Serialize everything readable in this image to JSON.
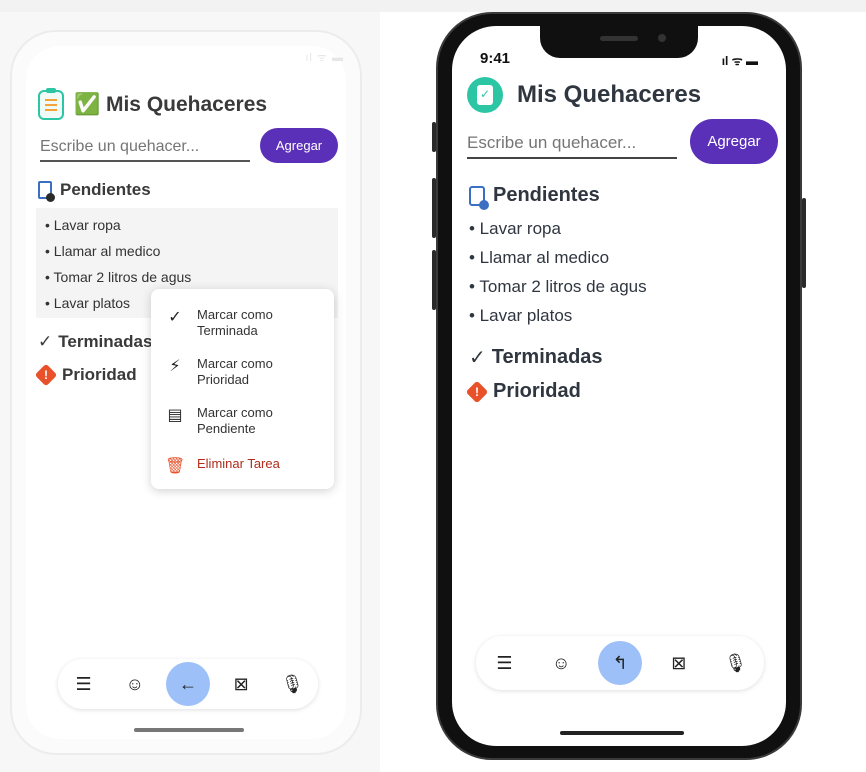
{
  "left_screen": {
    "title": "✅ Mis Quehaceres",
    "input_placeholder": "Escribe un quehacer...",
    "add_button": "Agregar",
    "sections": {
      "pending": "Pendientes",
      "done": "Terminadas",
      "priority": "Prioridad"
    },
    "pending_items": [
      "• Lavar ropa",
      "• Llamar al medico",
      "• Tomar 2 litros de agus",
      "• Lavar platos"
    ],
    "context_menu": {
      "mark_done": "Marcar como Terminada",
      "mark_priority": "Marcar como Prioridad",
      "mark_pending": "Marcar como Pendiente",
      "delete": "Eliminar Tarea"
    },
    "status_bar": "ıl ᯤ ▬"
  },
  "right_screen": {
    "time": "9:41",
    "status_icons": "ıl ᯤ ▬",
    "title": "Mis Quehaceres",
    "input_placeholder": "Escribe un quehacer...",
    "add_button": "Agregar",
    "sections": {
      "pending": "Pendientes",
      "done": "Terminadas",
      "priority": "Prioridad"
    },
    "pending_items": [
      "• Lavar ropa",
      "• Llamar al medico",
      "• Tomar 2 litros de agus",
      "• Lavar platos"
    ]
  },
  "toolbar_icons": [
    "menu-icon",
    "emoji-icon",
    "back-arrow-icon",
    "close-box-icon",
    "microphone-icon"
  ],
  "colors": {
    "accent_purple": "#5b30b8",
    "teal": "#2cc6a4",
    "active_tool": "#9cc0f7",
    "priority_red": "#e8512a"
  }
}
